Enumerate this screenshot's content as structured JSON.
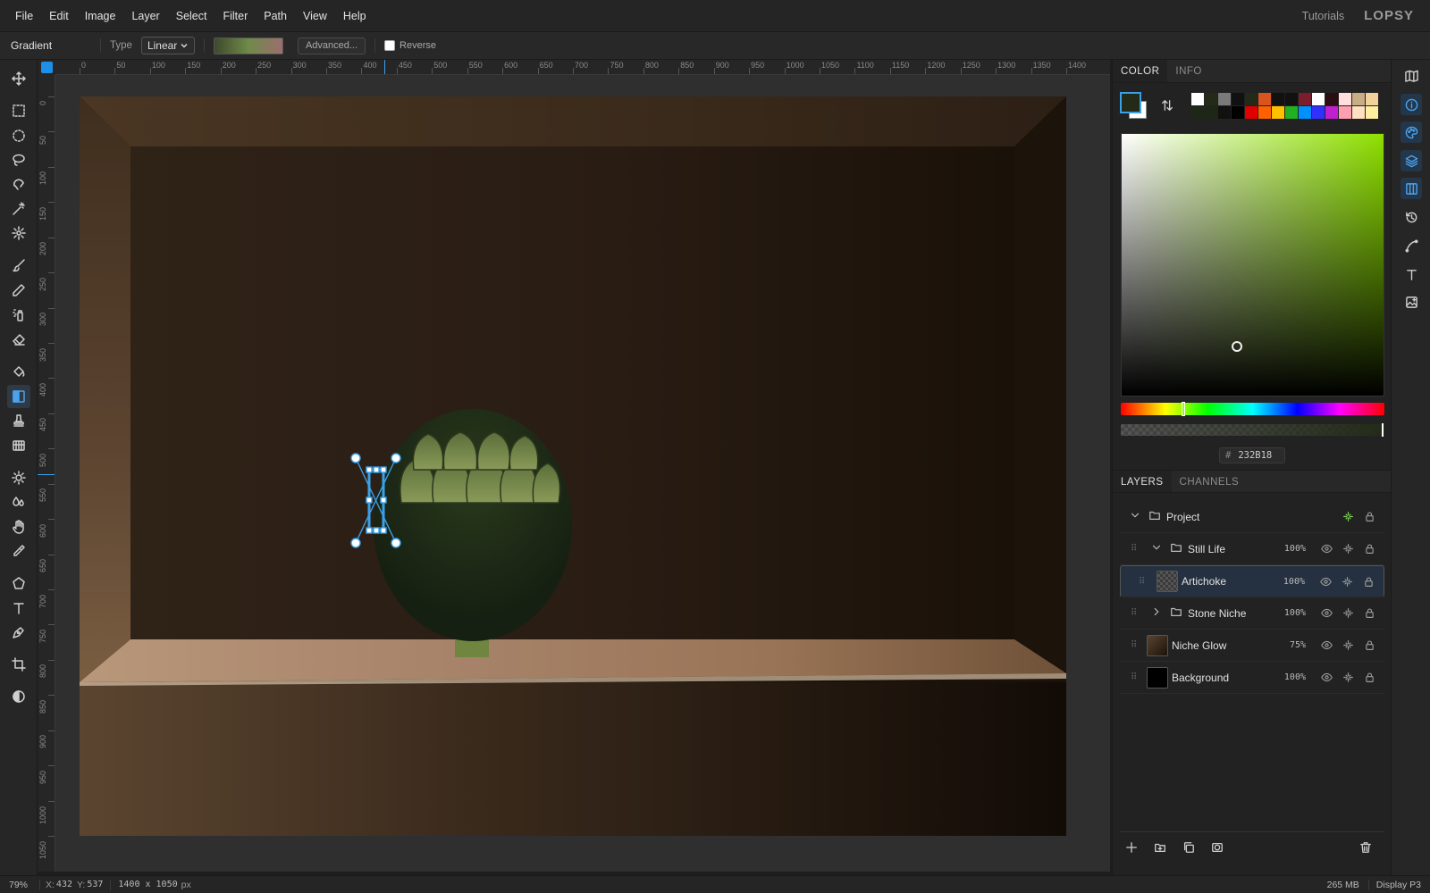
{
  "menu": [
    "File",
    "Edit",
    "Image",
    "Layer",
    "Select",
    "Filter",
    "Path",
    "View",
    "Help"
  ],
  "header": {
    "tutorials": "Tutorials",
    "logo": "LOPSY"
  },
  "options": {
    "tool_name": "Gradient",
    "type_label": "Type",
    "type_value": "Linear",
    "advanced_label": "Advanced...",
    "reverse_label": "Reverse",
    "gradient_colors": [
      "#3e4a2c",
      "#6f8a4a",
      "#9b6e6e"
    ]
  },
  "rulers": {
    "h_labels": [
      "0",
      "50",
      "100",
      "150",
      "200",
      "250",
      "300",
      "350",
      "400",
      "450",
      "500",
      "550",
      "600",
      "650",
      "700",
      "750",
      "800",
      "850",
      "900",
      "950",
      "1000",
      "1050",
      "1100",
      "1150",
      "1200",
      "1250",
      "1300",
      "1350",
      "1400"
    ],
    "v_labels": [
      "0",
      "50",
      "100",
      "150",
      "200",
      "250",
      "300",
      "350",
      "400",
      "450",
      "500",
      "550",
      "600",
      "650",
      "700",
      "750",
      "800",
      "850",
      "900",
      "950",
      "1000",
      "1050"
    ]
  },
  "color_panel": {
    "tabs": [
      "COLOR",
      "INFO"
    ],
    "foreground": "#232b18",
    "background": "#ffffff",
    "hex_prefix": "#",
    "hex": "232B18",
    "hue_color": "#8ee000",
    "swatches_row1": [
      "#ffffff",
      "#232b18",
      "#7a7a7a",
      "#111111",
      "#232b18",
      "#d9541e",
      "#111111",
      "#111111",
      "#7b1d2a",
      "#ffffff",
      "#2a0e14",
      "#ffdede",
      "#c8ad85",
      "#f2d19a"
    ],
    "swatches_row2": [
      "#1e2616",
      "#1e2616",
      "#111111",
      "#000000",
      "#e00000",
      "#ff6000",
      "#ffc000",
      "#20b020",
      "#0090ff",
      "#3030ff",
      "#c020d0",
      "#ff9fb0",
      "#ffe0c0",
      "#fff0a0"
    ]
  },
  "layers_panel": {
    "tabs": [
      "LAYERS",
      "CHANNELS"
    ],
    "items": [
      {
        "name": "Project",
        "opacity": ""
      },
      {
        "name": "Still Life",
        "opacity": "100%"
      },
      {
        "name": "Artichoke",
        "opacity": "100%"
      },
      {
        "name": "Stone Niche",
        "opacity": "100%"
      },
      {
        "name": "Niche Glow",
        "opacity": "75%"
      },
      {
        "name": "Background",
        "opacity": "100%"
      }
    ]
  },
  "status": {
    "zoom": "79%",
    "coords_x_label": "X:",
    "coords_x": "432",
    "coords_y_label": "Y:",
    "coords_y": "537",
    "doc_size": "1400 x 1050",
    "doc_unit": "px",
    "memory": "265 MB",
    "color_profile": "Display P3"
  }
}
